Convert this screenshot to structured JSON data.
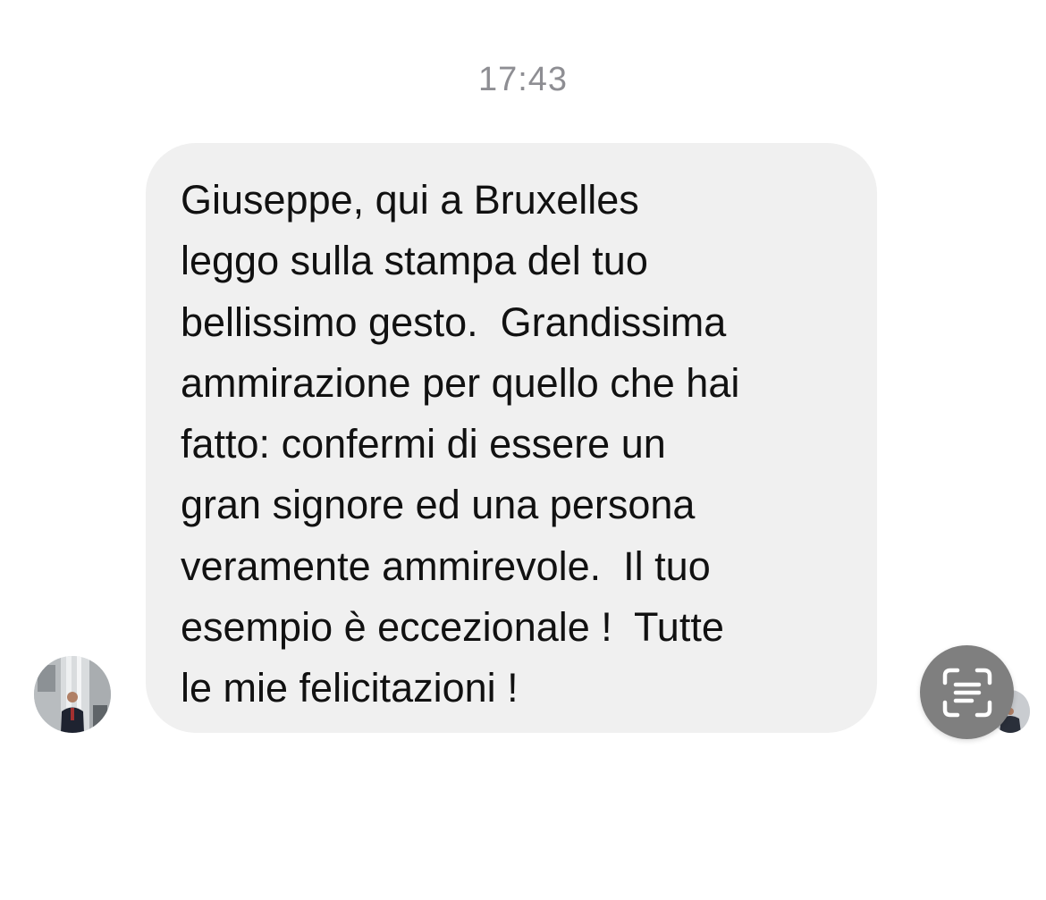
{
  "conversation": {
    "timestamp": "17:43",
    "message": {
      "lines": [
        "Giuseppe, qui a Bruxelles",
        "leggo sulla stampa del tuo",
        "bellissimo gesto.  Grandissima",
        "ammirazione per quello che hai",
        "fatto: confermi di essere un",
        "gran signore ed una persona",
        "veramente ammirevole.  Il tuo",
        "esempio è eccezionale !  Tutte",
        "le mie felicitazioni !"
      ]
    },
    "sender_avatar": "person-photo",
    "live_text_icon": "live-text-scan-icon"
  },
  "colors": {
    "bubble": "#f0f0f0",
    "text": "#111111",
    "timestamp": "#8e8e93",
    "live_text_button": "#7f7f7f"
  }
}
